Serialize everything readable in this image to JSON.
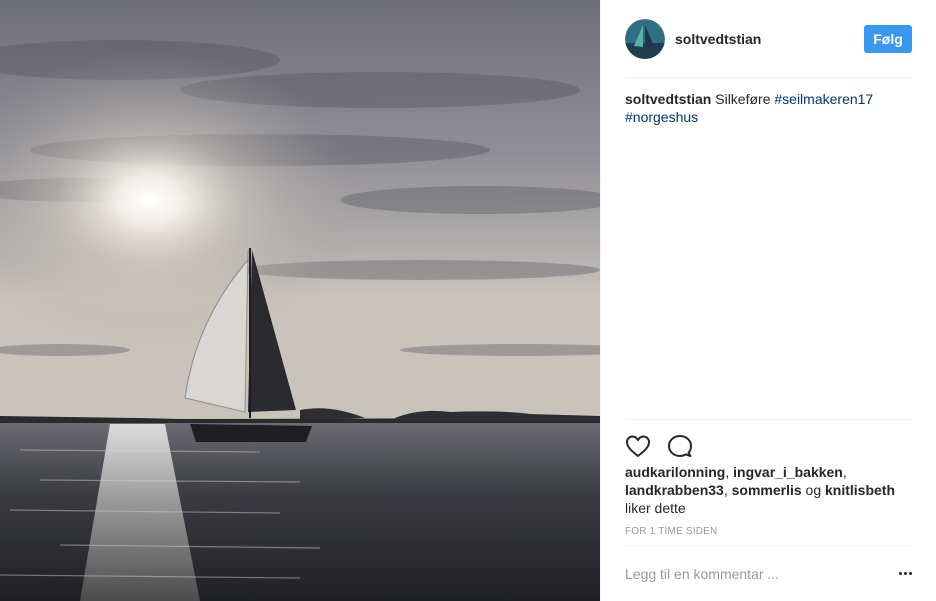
{
  "post": {
    "username": "soltvedtstian",
    "follow_label": "Følg",
    "caption": {
      "username": "soltvedtstian",
      "text": "Silkeføre",
      "hashtags": [
        "#seilmakeren17",
        "#norgeshus"
      ]
    },
    "likes": {
      "users": [
        "audkarilonning",
        "ingvar_i_bakken",
        "landkrabben33",
        "sommerlis",
        "knitlisbeth"
      ],
      "connector": "og",
      "suffix": "liker dette"
    },
    "time_ago": "FOR 1 TIME SIDEN",
    "comment_placeholder": "Legg til en kommentar ...",
    "icons": {
      "like": "heart-icon",
      "comment": "comment-icon",
      "more": "more-options-icon"
    },
    "colors": {
      "accent": "#3897f0",
      "hashtag": "#003569",
      "muted": "#999999"
    }
  }
}
